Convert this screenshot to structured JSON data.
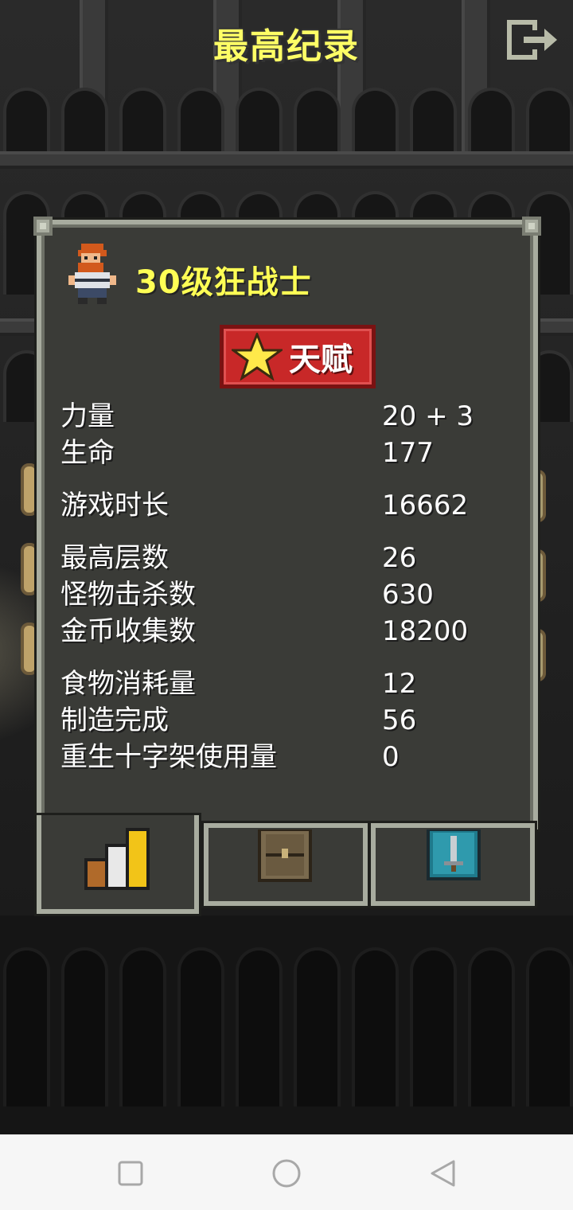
{
  "screen": {
    "title": "最高纪录"
  },
  "hero": {
    "title": "30级狂战士"
  },
  "talent": {
    "label": "天赋"
  },
  "stats": [
    {
      "label": "力量",
      "value": "20 + 3"
    },
    {
      "label": "生命",
      "value": "177"
    },
    {
      "label": "游戏时长",
      "value": "16662"
    },
    {
      "label": "最高层数",
      "value": "26"
    },
    {
      "label": "怪物击杀数",
      "value": "630"
    },
    {
      "label": "金币收集数",
      "value": "18200"
    },
    {
      "label": "食物消耗量",
      "value": "12"
    },
    {
      "label": "制造完成",
      "value": "56"
    },
    {
      "label": "重生十字架使用量",
      "value": "0"
    }
  ],
  "tabs": [
    {
      "icon": "stats-bars-icon",
      "active": true
    },
    {
      "icon": "wooden-chest-icon",
      "active": false
    },
    {
      "icon": "sword-badge-icon",
      "active": false
    }
  ],
  "navbar": {
    "buttons": [
      "recent-apps-icon",
      "home-icon",
      "back-icon"
    ]
  },
  "colors": {
    "title_yellow": "#ffff66",
    "panel_bg": "#3a3b37",
    "panel_border": "#a8ac9f",
    "talent_red": "#c82828"
  }
}
